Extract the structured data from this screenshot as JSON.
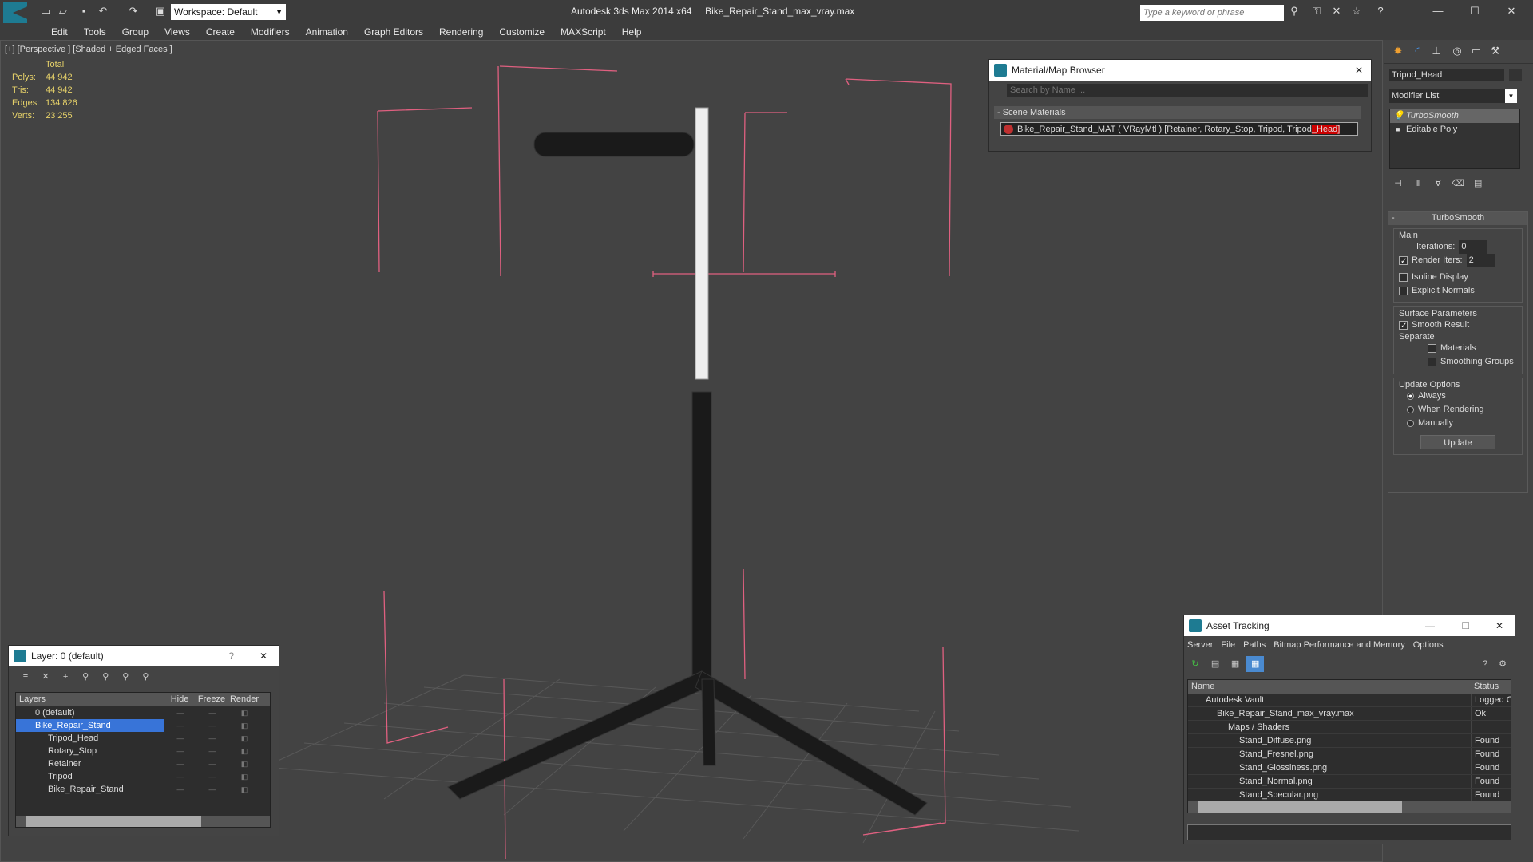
{
  "window": {
    "app_title": "Autodesk 3ds Max  2014 x64",
    "file_title": "Bike_Repair_Stand_max_vray.max",
    "workspace": "Workspace: Default",
    "search_placeholder": "Type a keyword or phrase"
  },
  "menu": [
    "Edit",
    "Tools",
    "Group",
    "Views",
    "Create",
    "Modifiers",
    "Animation",
    "Graph Editors",
    "Rendering",
    "Customize",
    "MAXScript",
    "Help"
  ],
  "viewport": {
    "label": "[+] [Perspective ] [Shaded + Edged Faces ]",
    "stats_header": "Total",
    "stats": [
      {
        "k": "Polys:",
        "v": "44 942"
      },
      {
        "k": "Tris:",
        "v": "44 942"
      },
      {
        "k": "Edges:",
        "v": "134 826"
      },
      {
        "k": "Verts:",
        "v": "23 255"
      }
    ]
  },
  "material_browser": {
    "title": "Material/Map Browser",
    "search_placeholder": "Search by Name ...",
    "section": "- Scene Materials",
    "item_prefix": "Bike_Repair_Stand_MAT  ( VRayMtl )  [Retainer, Rotary_Stop, Tripod, Tripod",
    "item_highlight": "_Head]"
  },
  "command_panel": {
    "object_name": "Tripod_Head",
    "modifier_list": "Modifier List",
    "stack": [
      "TurboSmooth",
      "Editable Poly"
    ],
    "rollout": "TurboSmooth",
    "main": "Main",
    "iterations_label": "Iterations:",
    "iterations": "0",
    "render_iters_label": "Render Iters:",
    "render_iters": "2",
    "isoline": "Isoline Display",
    "explicit": "Explicit Normals",
    "surface": "Surface Parameters",
    "smooth_result": "Smooth Result",
    "separate": "Separate",
    "materials": "Materials",
    "smoothing_groups": "Smoothing Groups",
    "update_options": "Update Options",
    "always": "Always",
    "when_rendering": "When Rendering",
    "manually": "Manually",
    "update_btn": "Update"
  },
  "layer_panel": {
    "title": "Layer: 0 (default)",
    "cols": [
      "Layers",
      "Hide",
      "Freeze",
      "Render"
    ],
    "rows": [
      {
        "name": "0 (default)",
        "indent": 1,
        "selected": false
      },
      {
        "name": "Bike_Repair_Stand",
        "indent": 1,
        "selected": true
      },
      {
        "name": "Tripod_Head",
        "indent": 2,
        "selected": false
      },
      {
        "name": "Rotary_Stop",
        "indent": 2,
        "selected": false
      },
      {
        "name": "Retainer",
        "indent": 2,
        "selected": false
      },
      {
        "name": "Tripod",
        "indent": 2,
        "selected": false
      },
      {
        "name": "Bike_Repair_Stand",
        "indent": 2,
        "selected": false
      }
    ]
  },
  "asset_tracking": {
    "title": "Asset Tracking",
    "menu": [
      "Server",
      "File",
      "Paths",
      "Bitmap Performance and Memory",
      "Options"
    ],
    "cols": [
      "Name",
      "Status"
    ],
    "rows": [
      {
        "name": "Autodesk Vault",
        "status": "Logged O",
        "indent": 1
      },
      {
        "name": "Bike_Repair_Stand_max_vray.max",
        "status": "Ok",
        "indent": 2
      },
      {
        "name": "Maps / Shaders",
        "status": "",
        "indent": 3
      },
      {
        "name": "Stand_Diffuse.png",
        "status": "Found",
        "indent": 4
      },
      {
        "name": "Stand_Fresnel.png",
        "status": "Found",
        "indent": 4
      },
      {
        "name": "Stand_Glossiness.png",
        "status": "Found",
        "indent": 4
      },
      {
        "name": "Stand_Normal.png",
        "status": "Found",
        "indent": 4
      },
      {
        "name": "Stand_Specular.png",
        "status": "Found",
        "indent": 4
      }
    ]
  }
}
